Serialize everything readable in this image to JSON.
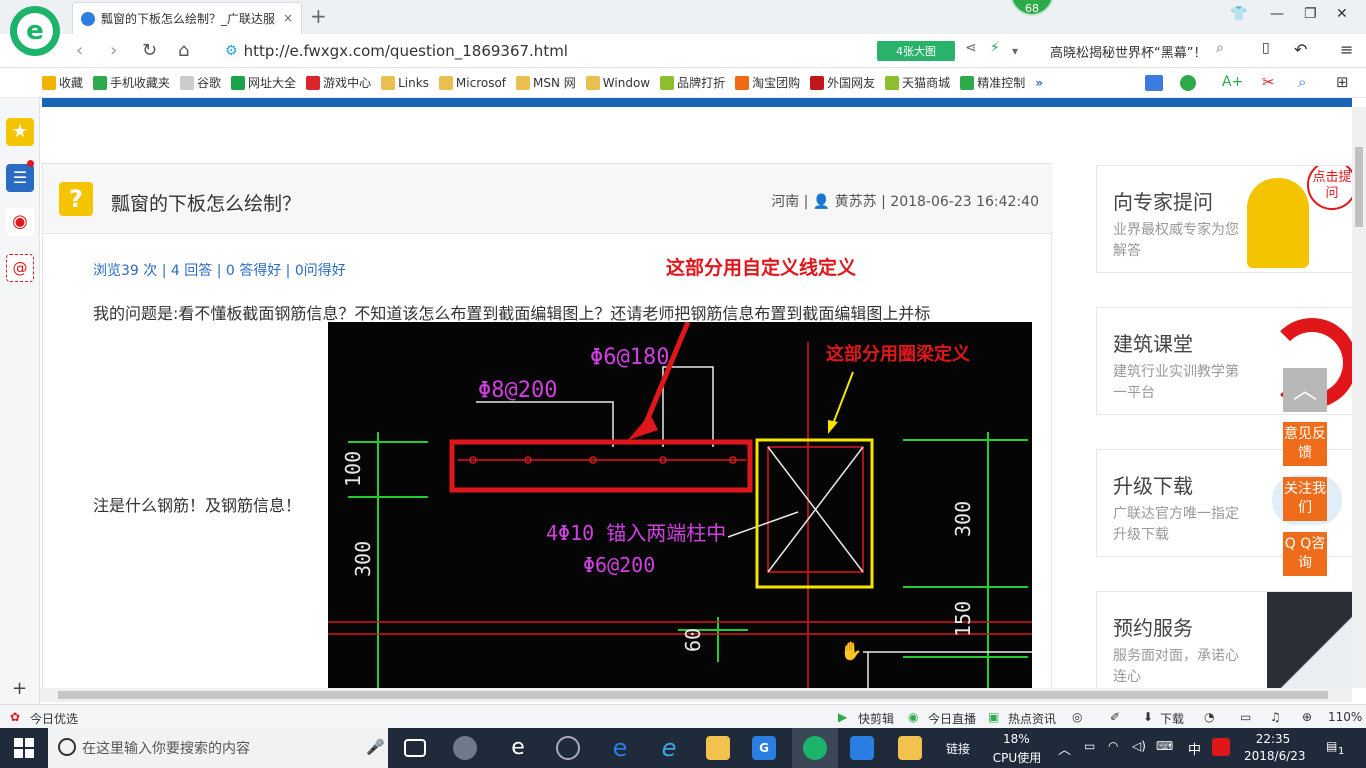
{
  "browser": {
    "tab_title": "瓢窗的下板怎么绘制？_广联达服",
    "tab_close": "×",
    "new_tab": "+",
    "badge_count": "68",
    "url": "http://e.fwxgx.com/question_1869367.html",
    "big_pic_label": "4张大图",
    "news_ticker": "高晓松揭秘世界杯“黑幕”！"
  },
  "bookmarks": [
    {
      "label": "收藏",
      "color": "#f2b300"
    },
    {
      "label": "手机收藏夹",
      "color": "#2eaa4c"
    },
    {
      "label": "谷歌",
      "color": "#bbbbbb"
    },
    {
      "label": "网址大全",
      "color": "#1aa34a"
    },
    {
      "label": "游戏中心",
      "color": "#d9262c"
    },
    {
      "label": "Links",
      "color": "#e9c050"
    },
    {
      "label": "Microsof",
      "color": "#e9c050"
    },
    {
      "label": "MSN 网",
      "color": "#e9c050"
    },
    {
      "label": "Window",
      "color": "#e9c050"
    },
    {
      "label": "品牌打折",
      "color": "#8bbf2d"
    },
    {
      "label": "淘宝团购",
      "color": "#f06a13"
    },
    {
      "label": "外国网友",
      "color": "#c0171b"
    },
    {
      "label": "天猫商城",
      "color": "#8bbf2d"
    },
    {
      "label": "精准控制",
      "color": "#2eaa4c"
    }
  ],
  "question": {
    "title": "瓢窗的下板怎么绘制？",
    "meta": "河南 | 👤 黄苏苏 | 2018-06-23 16:42:40",
    "stats": "浏览39 次 | 4 回答 | 0 答得好 | 0问得好",
    "text_line1": "我的问题是:看不懂板截面钢筋信息？不知道该怎么布置到截面编辑图上？还请老师把钢筋信息布置到截面编辑图上并标",
    "text_line2": "注是什么钢筋！及钢筋信息！",
    "annotation1": "这部分用自定义线定义",
    "annotation2": "这部分用圈梁定义"
  },
  "cad": {
    "labels": [
      "Φ6@180",
      "Φ8@200",
      "4Φ10 锚入两端柱中",
      "Φ6@200",
      "100",
      "300",
      "300",
      "150",
      "60"
    ]
  },
  "right_cards": [
    {
      "title": "向专家提问",
      "sub": "业界最权威专家为您解答"
    },
    {
      "title": "建筑课堂",
      "sub": "建筑行业实训教学第一平台"
    },
    {
      "title": "升级下载",
      "sub": "广联达官方唯一指定升级下载"
    },
    {
      "title": "预约服务",
      "sub": "服务面对面，承诺心连心"
    }
  ],
  "right_badge": "点击提问",
  "float_buttons": [
    "意见反馈",
    "关注我们",
    "Q Q咨询"
  ],
  "status": {
    "left": "今日优选",
    "items": [
      "快剪辑",
      "今日直播",
      "热点资讯",
      "下载"
    ],
    "zoom": "110%"
  },
  "taskbar": {
    "search_placeholder": "在这里输入你要搜索的内容",
    "link_label": "链接",
    "cpu_value": "18%",
    "cpu_label": "CPU使用",
    "ime": "中",
    "time": "22:35",
    "date": "2018/6/23",
    "notif_count": "1"
  },
  "colors": {
    "brand_green": "#1cb46a",
    "band_blue": "#1764b5",
    "annotation_red": "#e0161a",
    "highlight_yellow": "#f5e400",
    "float_orange": "#ef6c1b"
  }
}
